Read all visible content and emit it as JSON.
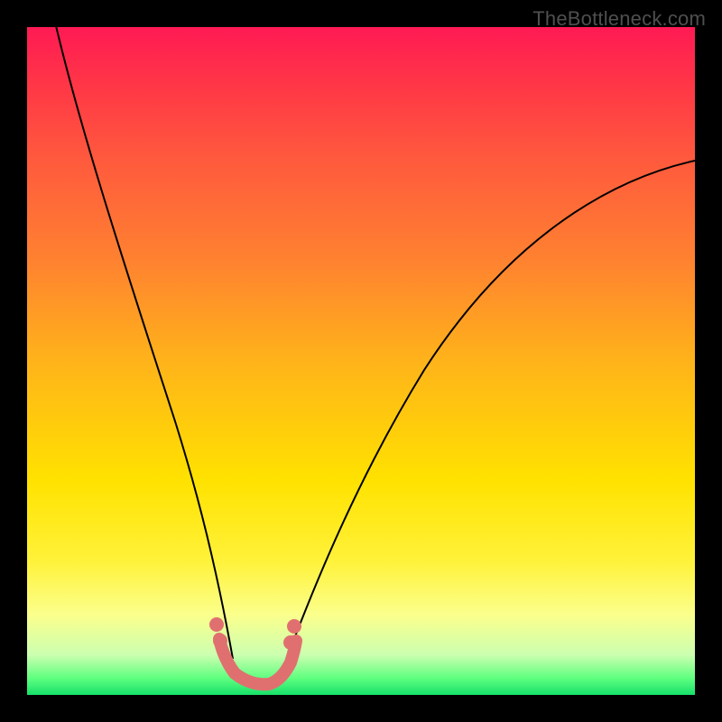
{
  "watermark": "TheBottleneck.com",
  "colors": {
    "frame": "#000000",
    "top_gradient": "#ff1a54",
    "bottom_gradient": "#16e06a",
    "curve": "#000000",
    "marker": "#e07070"
  },
  "chart_data": {
    "type": "line",
    "title": "",
    "xlabel": "",
    "ylabel": "",
    "xlim": [
      0,
      100
    ],
    "ylim": [
      0,
      100
    ],
    "grid": false,
    "legend": false,
    "series": [
      {
        "name": "left-branch",
        "x": [
          4,
          7,
          10,
          13,
          16,
          19,
          21,
          23,
          25,
          26.5,
          28,
          29.5,
          30.8
        ],
        "y": [
          100,
          90,
          80,
          70,
          60,
          50,
          42,
          34,
          26,
          19,
          12,
          6,
          2
        ]
      },
      {
        "name": "right-branch",
        "x": [
          38,
          40,
          43,
          47,
          52,
          58,
          64,
          71,
          78,
          86,
          94,
          100
        ],
        "y": [
          2,
          6,
          13,
          22,
          32,
          42,
          51,
          59,
          66,
          72,
          77,
          80
        ]
      },
      {
        "name": "bottom-u",
        "x": [
          28.5,
          29.5,
          30.5,
          32,
          34,
          36,
          37.5,
          38.5,
          39.5
        ],
        "y": [
          8,
          5,
          3,
          2,
          2,
          2,
          3,
          5,
          8
        ]
      }
    ],
    "markers": [
      {
        "name": "left-dot-1",
        "x": 28.3,
        "y": 10
      },
      {
        "name": "left-dot-2",
        "x": 29.0,
        "y": 7
      },
      {
        "name": "right-dot-1",
        "x": 39.0,
        "y": 7
      },
      {
        "name": "right-dot-2",
        "x": 39.8,
        "y": 10
      }
    ]
  }
}
